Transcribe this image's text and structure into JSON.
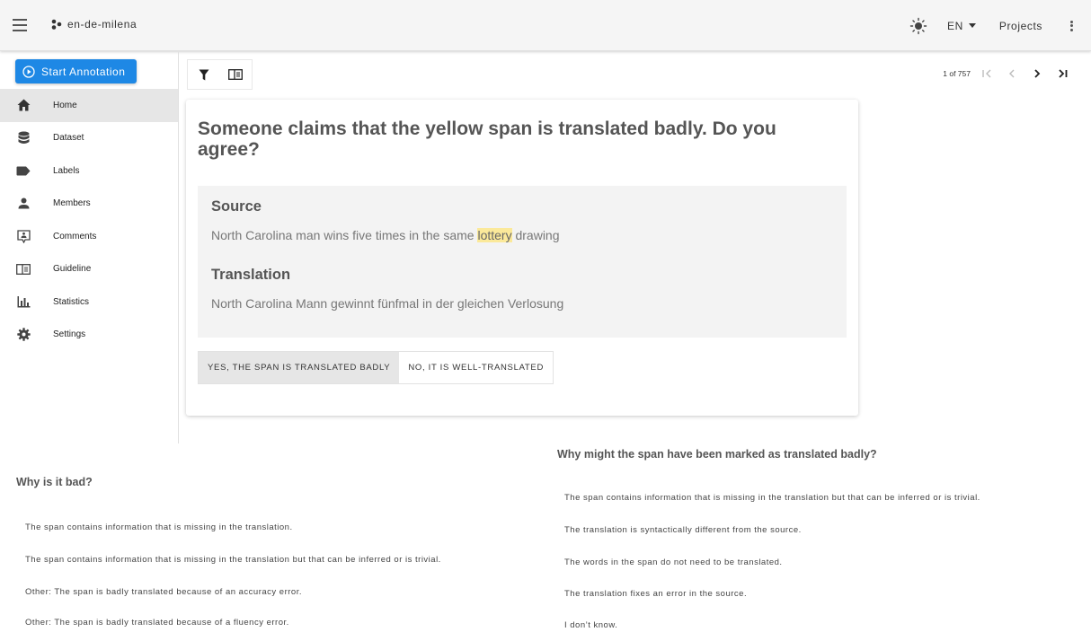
{
  "appbar": {
    "project_name": "en-de-milena",
    "language": "EN",
    "projects_label": "Projects"
  },
  "sidebar": {
    "start_button": "Start Annotation",
    "items": [
      {
        "label": "Home",
        "icon": "home-icon",
        "active": true
      },
      {
        "label": "Dataset",
        "icon": "database-icon"
      },
      {
        "label": "Labels",
        "icon": "label-icon"
      },
      {
        "label": "Members",
        "icon": "person-icon"
      },
      {
        "label": "Comments",
        "icon": "comment-icon"
      },
      {
        "label": "Guideline",
        "icon": "book-icon"
      },
      {
        "label": "Statistics",
        "icon": "chart-icon"
      },
      {
        "label": "Settings",
        "icon": "gear-icon"
      }
    ]
  },
  "pager": {
    "position": "1 of 757"
  },
  "card": {
    "question": "Someone claims that the yellow span is translated badly. Do you agree?",
    "source_heading": "Source",
    "source_before": "North Carolina man wins five times in the same ",
    "source_highlight": "lottery",
    "source_after": " drawing",
    "translation_heading": "Translation",
    "translation_text": "North Carolina Mann gewinnt fünfmal in der gleichen Verlosung",
    "choice_yes": "YES, THE SPAN IS TRANSLATED BADLY",
    "choice_no": "NO, IT IS WELL-TRANSLATED",
    "highlight_color": "#fbe99a"
  },
  "why_bad": {
    "title": "Why is it bad?",
    "options": [
      "The span contains information that is missing in the translation.",
      "The span contains information that is missing in the translation but that can be inferred or is trivial.",
      "Other: The span is badly translated because of an accuracy error.",
      "Other: The span is badly translated because of a fluency error."
    ]
  },
  "why_marked": {
    "title": "Why might the span have been marked as translated badly?",
    "options": [
      "The span contains information that is missing in the translation but that can be inferred or is trivial.",
      "The translation is syntactically different from the source.",
      "The words in the span do not need to be translated.",
      "The translation fixes an error in the source.",
      "I don’t know."
    ]
  },
  "colors": {
    "primary": "#1e88e5",
    "appbar": "#f5f5f5"
  }
}
